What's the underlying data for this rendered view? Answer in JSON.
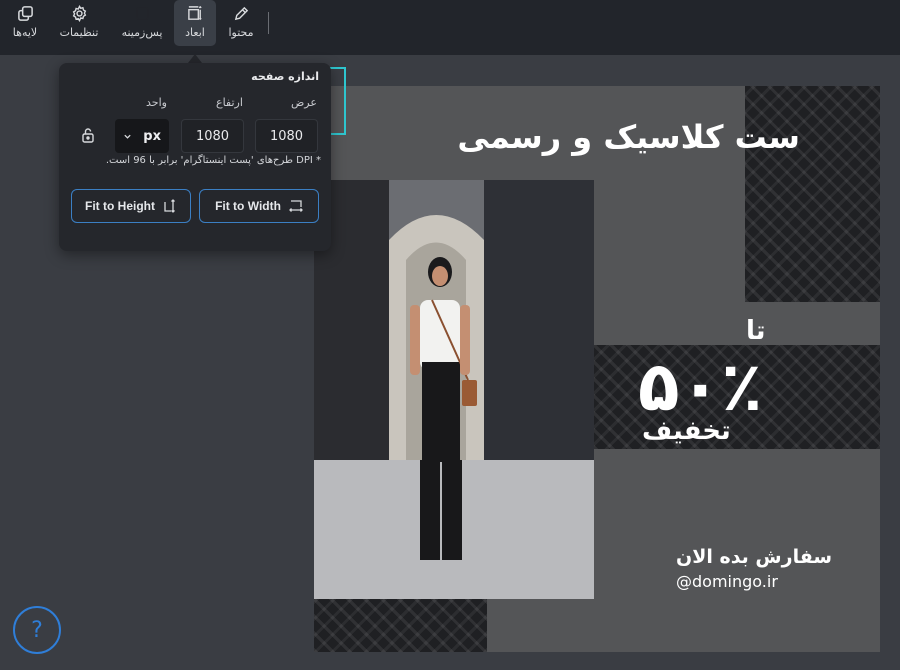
{
  "toolbar": {
    "items": [
      {
        "label": "لایه‌ها",
        "icon": "layers-icon"
      },
      {
        "label": "تنظیمات",
        "icon": "gear-icon"
      },
      {
        "label": "پس‌زمینه",
        "icon": "background-icon"
      },
      {
        "label": "ابعاد",
        "icon": "resize-icon",
        "active": true
      },
      {
        "label": "محتوا",
        "icon": "pencil-icon"
      }
    ]
  },
  "size_panel": {
    "title": "اندازه صفحه",
    "width_label": "عرض",
    "height_label": "ارتفاع",
    "unit_label": "واحد",
    "width_value": "1080",
    "height_value": "1080",
    "unit_value": "px",
    "dpi_note": "* DPI طرح‌های 'پست اینستاگرام' برابر با 96 است.",
    "fit_width_label": "Fit to Width",
    "fit_height_label": "Fit to Height"
  },
  "design": {
    "headline": "ست کلاسیک و رسمی",
    "up_to": "تا",
    "percent": "۵۰٪",
    "discount": "تخفیف",
    "order_now": "سفارش بده الان",
    "handle": "@domingo.ir"
  },
  "help": {
    "label": "?"
  },
  "colors": {
    "toolbar_bg": "#22252b",
    "workspace_bg": "#3a3d43",
    "panel_bg": "#25272c",
    "accent_blue": "#3b7fc4",
    "accent_cyan": "#2fc7d0"
  }
}
